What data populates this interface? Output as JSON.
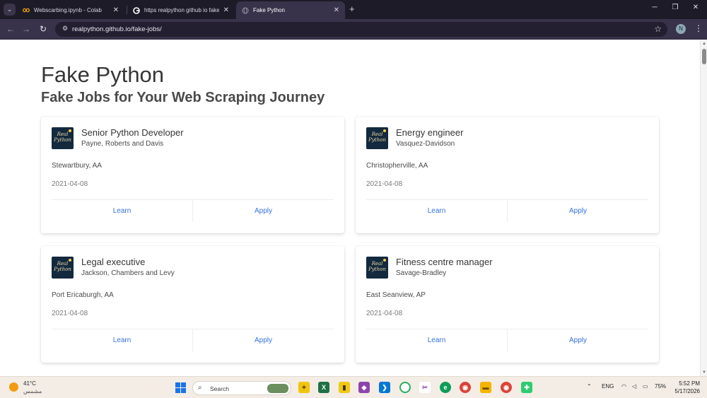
{
  "browser": {
    "tabs": [
      {
        "title": "Webscarbing.ipynb - Colab",
        "icon": "colab-icon"
      },
      {
        "title": "https realpython github io fake",
        "icon": "google-icon"
      },
      {
        "title": "Fake Python",
        "icon": "globe-icon",
        "active": true
      }
    ],
    "new_tab": "+",
    "url": "realpython.github.io/fake-jobs/",
    "profile_initial": "N",
    "window_controls": {
      "minimize": "─",
      "maximize": "❐",
      "close": "✕"
    }
  },
  "page": {
    "title": "Fake Python",
    "subtitle": "Fake Jobs for Your Web Scraping Journey",
    "logo_text": {
      "line1": "Real",
      "line2": "Python"
    },
    "jobs": [
      {
        "title": "Senior Python Developer",
        "company": "Payne, Roberts and Davis",
        "location": "Stewartbury, AA",
        "date": "2021-04-08",
        "learn": "Learn",
        "apply": "Apply"
      },
      {
        "title": "Energy engineer",
        "company": "Vasquez-Davidson",
        "location": "Christopherville, AA",
        "date": "2021-04-08",
        "learn": "Learn",
        "apply": "Apply"
      },
      {
        "title": "Legal executive",
        "company": "Jackson, Chambers and Levy",
        "location": "Port Ericaburgh, AA",
        "date": "2021-04-08",
        "learn": "Learn",
        "apply": "Apply"
      },
      {
        "title": "Fitness centre manager",
        "company": "Savage-Bradley",
        "location": "East Seanview, AP",
        "date": "2021-04-08",
        "learn": "Learn",
        "apply": "Apply"
      }
    ]
  },
  "taskbar": {
    "weather": {
      "temp": "41°C",
      "desc": "مشمس"
    },
    "search_placeholder": "Search",
    "tray": {
      "language": "ENG",
      "battery": "75%"
    },
    "clock": {
      "time": "5:52 PM",
      "date": "5/17/2026"
    }
  },
  "colors": {
    "link": "#3273dc",
    "title": "#363636",
    "logo_bg": "#13293d",
    "tab_bar": "#1e1b29",
    "toolbar": "#38334a"
  }
}
